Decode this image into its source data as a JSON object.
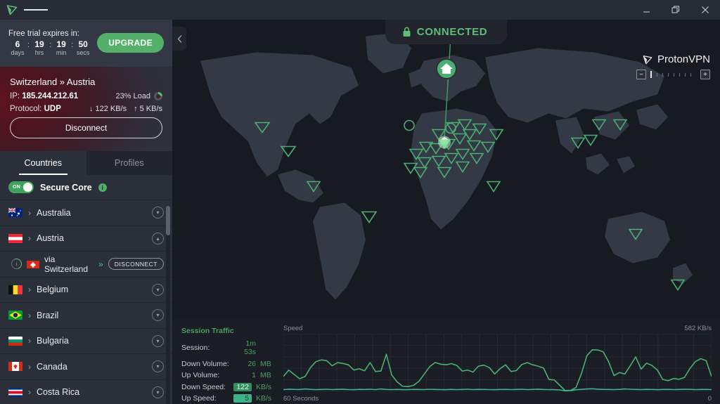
{
  "titlebar": {
    "logo_icon": "protonvpn-logo-icon",
    "menu_icon": "hamburger-menu-icon",
    "minimize_label": "—",
    "restore_label": "❐",
    "close_label": "✕"
  },
  "trial": {
    "title": "Free trial expires in:",
    "units": [
      {
        "value": "6",
        "label": "days"
      },
      {
        "value": "19",
        "label": "hrs"
      },
      {
        "value": "19",
        "label": "min"
      },
      {
        "value": "50",
        "label": "secs"
      }
    ],
    "separator": ":",
    "upgrade_label": "UPGRADE"
  },
  "connection": {
    "route": "Switzerland » Austria",
    "ip_label": "IP:",
    "ip_value": "185.244.212.61",
    "load_text": "23% Load",
    "load_percent": 23,
    "protocol_label": "Protocol:",
    "protocol_value": "UDP",
    "down_speed": "122 KB/s",
    "up_speed": "5 KB/s",
    "down_arrow": "↓",
    "up_arrow": "↑",
    "disconnect_label": "Disconnect"
  },
  "tabs": [
    {
      "label": "Countries",
      "active": true
    },
    {
      "label": "Profiles",
      "active": false
    }
  ],
  "secure_core": {
    "toggle_state": "ON",
    "label": "Secure Core",
    "info_icon": "info-icon",
    "info_glyph": "i"
  },
  "countries": [
    {
      "name": "Australia",
      "flag": "au",
      "expanded": false,
      "chevron": "›"
    },
    {
      "name": "Austria",
      "flag": "at",
      "expanded": true,
      "chevron": "›"
    },
    {
      "name": "Belgium",
      "flag": "be",
      "expanded": false,
      "chevron": "›"
    },
    {
      "name": "Brazil",
      "flag": "br",
      "expanded": false,
      "chevron": "›"
    },
    {
      "name": "Bulgaria",
      "flag": "bg",
      "expanded": false,
      "chevron": "›"
    },
    {
      "name": "Canada",
      "flag": "ca",
      "expanded": false,
      "chevron": "›"
    },
    {
      "name": "Costa Rica",
      "flag": "cr",
      "expanded": false,
      "chevron": "›"
    }
  ],
  "secure_core_row": {
    "via_label": "via Switzerland",
    "flag": "ch",
    "chevron": "»",
    "disconnect_label": "DISCONNECT"
  },
  "map": {
    "status_text": "CONNECTED",
    "lock_icon": "lock-icon",
    "home_icon": "home-marker-icon",
    "collapse_icon": "chevron-left-icon",
    "brand_name": "ProtonVPN",
    "brand_icon": "protonvpn-logo-icon",
    "zoom_minus": "−",
    "zoom_plus": "+",
    "zoom_level": 0
  },
  "traffic": {
    "title": "Session Traffic",
    "rows": [
      {
        "label": "Session:",
        "value": "1m 53s",
        "unit": "",
        "highlight": "none"
      },
      {
        "label": "Down Volume:",
        "value": "26",
        "unit": "MB",
        "highlight": "none"
      },
      {
        "label": "Up Volume:",
        "value": "1",
        "unit": "MB",
        "highlight": "none"
      },
      {
        "label": "Down Speed:",
        "value": "122",
        "unit": "KB/s",
        "highlight": "down"
      },
      {
        "label": "Up Speed:",
        "value": "5",
        "unit": "KB/s",
        "highlight": "up"
      }
    ]
  },
  "chart_data": {
    "type": "line",
    "title": "Speed",
    "xlabel": "",
    "ylabel": "Speed",
    "axis_left_label": "60 Seconds",
    "axis_right_label": "0",
    "max_label": "582 KB/s",
    "ylim": [
      0,
      582
    ],
    "xlim": [
      60,
      0
    ],
    "grid": true,
    "legend": "none",
    "series": [
      {
        "name": "Down Speed",
        "color": "#4caf72",
        "values": [
          150,
          215,
          170,
          128,
          150,
          240,
          300,
          318,
          310,
          258,
          290,
          282,
          268,
          215,
          228,
          208,
          290,
          200,
          205,
          375,
          165,
          95,
          52,
          48,
          60,
          100,
          175,
          250,
          292,
          275,
          268,
          280,
          262,
          205,
          215,
          195,
          255,
          265,
          240,
          175,
          230,
          268,
          200,
          210,
          272,
          290,
          268,
          255,
          235,
          120,
          115,
          60,
          8,
          10,
          40,
          180,
          360,
          420,
          418,
          400,
          300,
          160,
          190,
          175,
          260,
          348,
          225,
          285,
          262,
          215,
          120,
          108,
          130,
          122,
          140,
          230,
          300,
          330,
          310,
          150
        ]
      },
      {
        "name": "Up Speed",
        "color": "#3fb38f",
        "values": [
          18,
          22,
          20,
          19,
          24,
          20,
          18,
          19,
          21,
          18,
          20,
          22,
          18,
          17,
          20,
          19,
          21,
          18,
          24,
          19,
          18,
          20,
          17,
          18,
          20,
          19,
          18,
          21,
          19,
          18,
          17,
          20,
          18,
          19,
          21,
          18,
          20,
          19,
          18,
          17,
          19,
          20,
          18,
          19,
          21,
          18,
          20,
          22,
          19,
          18,
          17,
          14,
          6,
          8,
          16,
          20,
          24,
          26,
          22,
          20,
          19,
          18,
          20,
          24,
          21,
          19,
          18,
          20,
          19,
          17,
          19,
          20,
          18,
          19,
          21,
          20,
          18,
          19,
          20,
          18
        ]
      }
    ]
  }
}
